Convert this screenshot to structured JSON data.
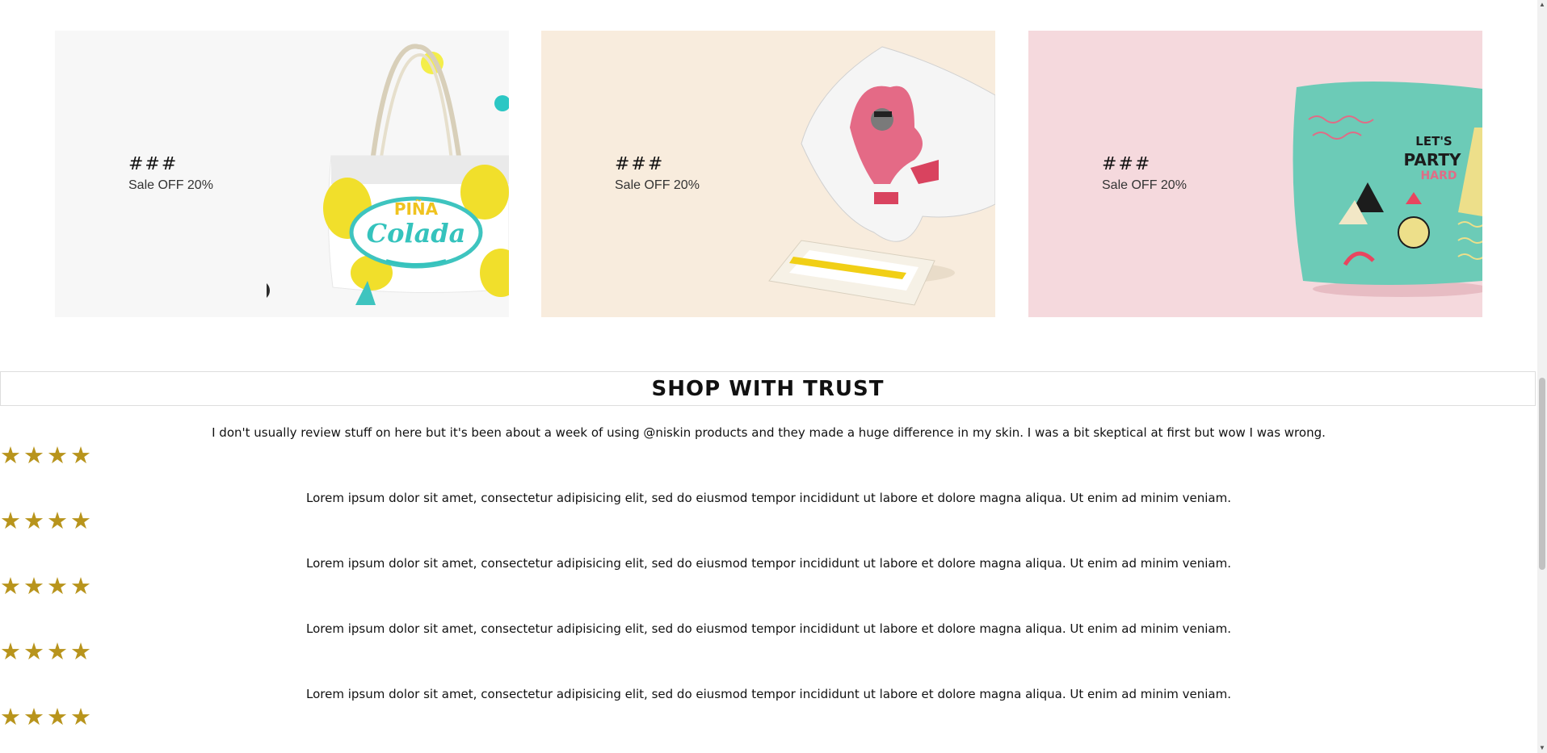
{
  "banners": [
    {
      "title": "###",
      "subtitle": "Sale OFF 20%",
      "bg": "#f7f7f7",
      "product": "tote-bag"
    },
    {
      "title": "###",
      "subtitle": "Sale OFF 20%",
      "bg": "#f8ecdd",
      "product": "pillow-tablet"
    },
    {
      "title": "###",
      "subtitle": "Sale OFF 20%",
      "bg": "#f5d9dd",
      "product": "party-pillow"
    }
  ],
  "bag_print": {
    "line1": "PIÑA",
    "line2": "Colada"
  },
  "pillow_print": {
    "line1": "LET'S",
    "line2": "PARTY",
    "line3": "HARD"
  },
  "trust": {
    "heading": "SHOP WITH TRUST",
    "rating": 4,
    "reviews": [
      {
        "text": "I don't usually review stuff on here but it's been about a week of using @niskin products and they made a huge difference in my skin. I was a bit skeptical at first but wow I was wrong."
      },
      {
        "text": "Lorem ipsum dolor sit amet, consectetur adipisicing elit, sed do eiusmod tempor incididunt ut labore et dolore magna aliqua. Ut enim ad minim veniam."
      },
      {
        "text": "Lorem ipsum dolor sit amet, consectetur adipisicing elit, sed do eiusmod tempor incididunt ut labore et dolore magna aliqua. Ut enim ad minim veniam."
      },
      {
        "text": "Lorem ipsum dolor sit amet, consectetur adipisicing elit, sed do eiusmod tempor incididunt ut labore et dolore magna aliqua. Ut enim ad minim veniam."
      },
      {
        "text": "Lorem ipsum dolor sit amet, consectetur adipisicing elit, sed do eiusmod tempor incididunt ut labore et dolore magna aliqua. Ut enim ad minim veniam."
      }
    ]
  },
  "colors": {
    "star": "#b8941c"
  },
  "icons": {
    "star": "star-icon",
    "scroll_up": "chevron-up-icon",
    "scroll_down": "chevron-down-icon"
  }
}
